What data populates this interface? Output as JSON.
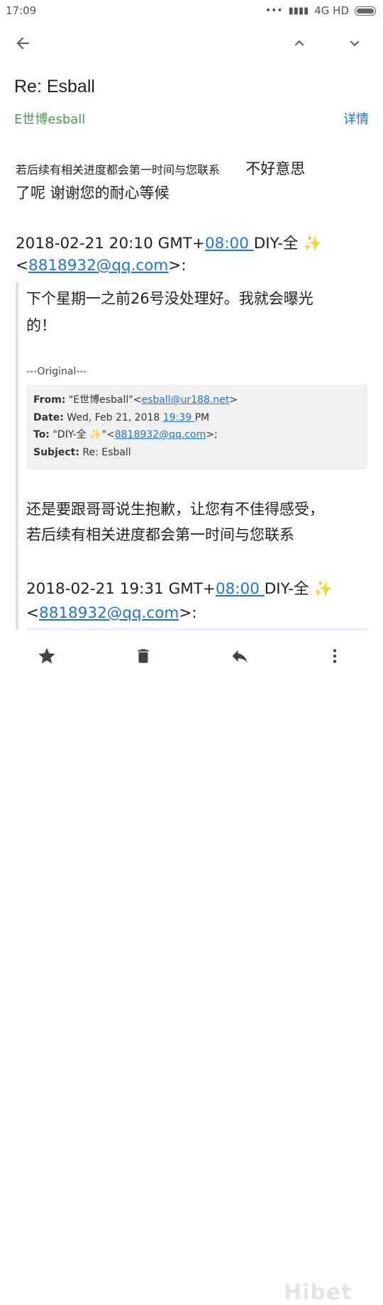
{
  "status_bar": {
    "time": "17:09",
    "signal": "4G HD"
  },
  "email": {
    "subject": "Re: Esball",
    "sender": "E世博esball",
    "details_label": "详情"
  },
  "body": {
    "line1_small": "若后续有相关进度都会第一时间与您联系",
    "line1_large": "不好意思",
    "line2": "了呢  谢谢您的耐心等候",
    "reply1_prefix": "2018-02-21 20:10 GMT+",
    "reply1_tz": "08:00 ",
    "reply1_name": "DIY-全 ",
    "reply1_email": "8818932@qq.com",
    "reply1_suffix": ">:",
    "quote1_line1": "下个星期一之前26号没处理好。我就会曝光",
    "quote1_line2": "的！",
    "original_marker": "---Original---",
    "header_from_label": "From:",
    "header_from_name": " \"E世博esball\"<",
    "header_from_email": "esball@ur188.net",
    "header_date_label": "Date:",
    "header_date_prefix": " Wed, Feb 21, 2018 ",
    "header_date_time": "19:39 ",
    "header_date_suffix": "PM",
    "header_to_label": "To:",
    "header_to_name": " \"DIY-全 ",
    "header_to_email": "8818932@qq.com",
    "header_to_suffix": ">;",
    "header_subject_label": "Subject:",
    "header_subject_value": " Re: Esball",
    "quote2_line1": "还是要跟哥哥说生抱歉，让您有不佳得感受，",
    "quote2_line2": "若后续有相关进度都会第一时间与您联系",
    "reply2_prefix": "2018-02-21 19:31 GMT+",
    "reply2_tz": "08:00 ",
    "reply2_name": "DIY-全 ",
    "reply2_email": "8818932@qq.com",
    "reply2_suffix": ">:"
  },
  "watermark": "Hibet",
  "colors": {
    "accent": "#1a73e8",
    "sender": "#43a047",
    "sparkle": "#f4b400"
  }
}
